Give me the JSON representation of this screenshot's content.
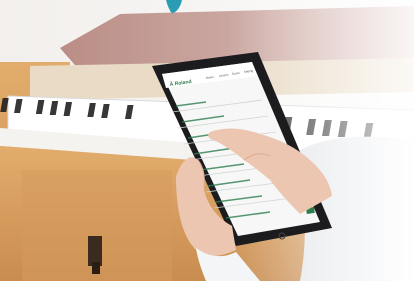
{
  "scene": {
    "description_free": true,
    "colors": {
      "wall": "#f4f2ef",
      "piano_wood": "#d9a262",
      "piano_dark": "#a86c3a",
      "piano_top": "#b98a80",
      "tablet_frame": "#1c1c1e",
      "screen_bg": "#f6f7f6",
      "app_green": "#2e7d4f",
      "sleeve": "#f7f7f8",
      "skin": "#ecc6b0",
      "teal_accent": "#2a9db5"
    },
    "tablet": {
      "app_brand": "Ā Roland",
      "nav_items": [
        "Home",
        "Lesson",
        "Score",
        "Setting"
      ]
    }
  }
}
